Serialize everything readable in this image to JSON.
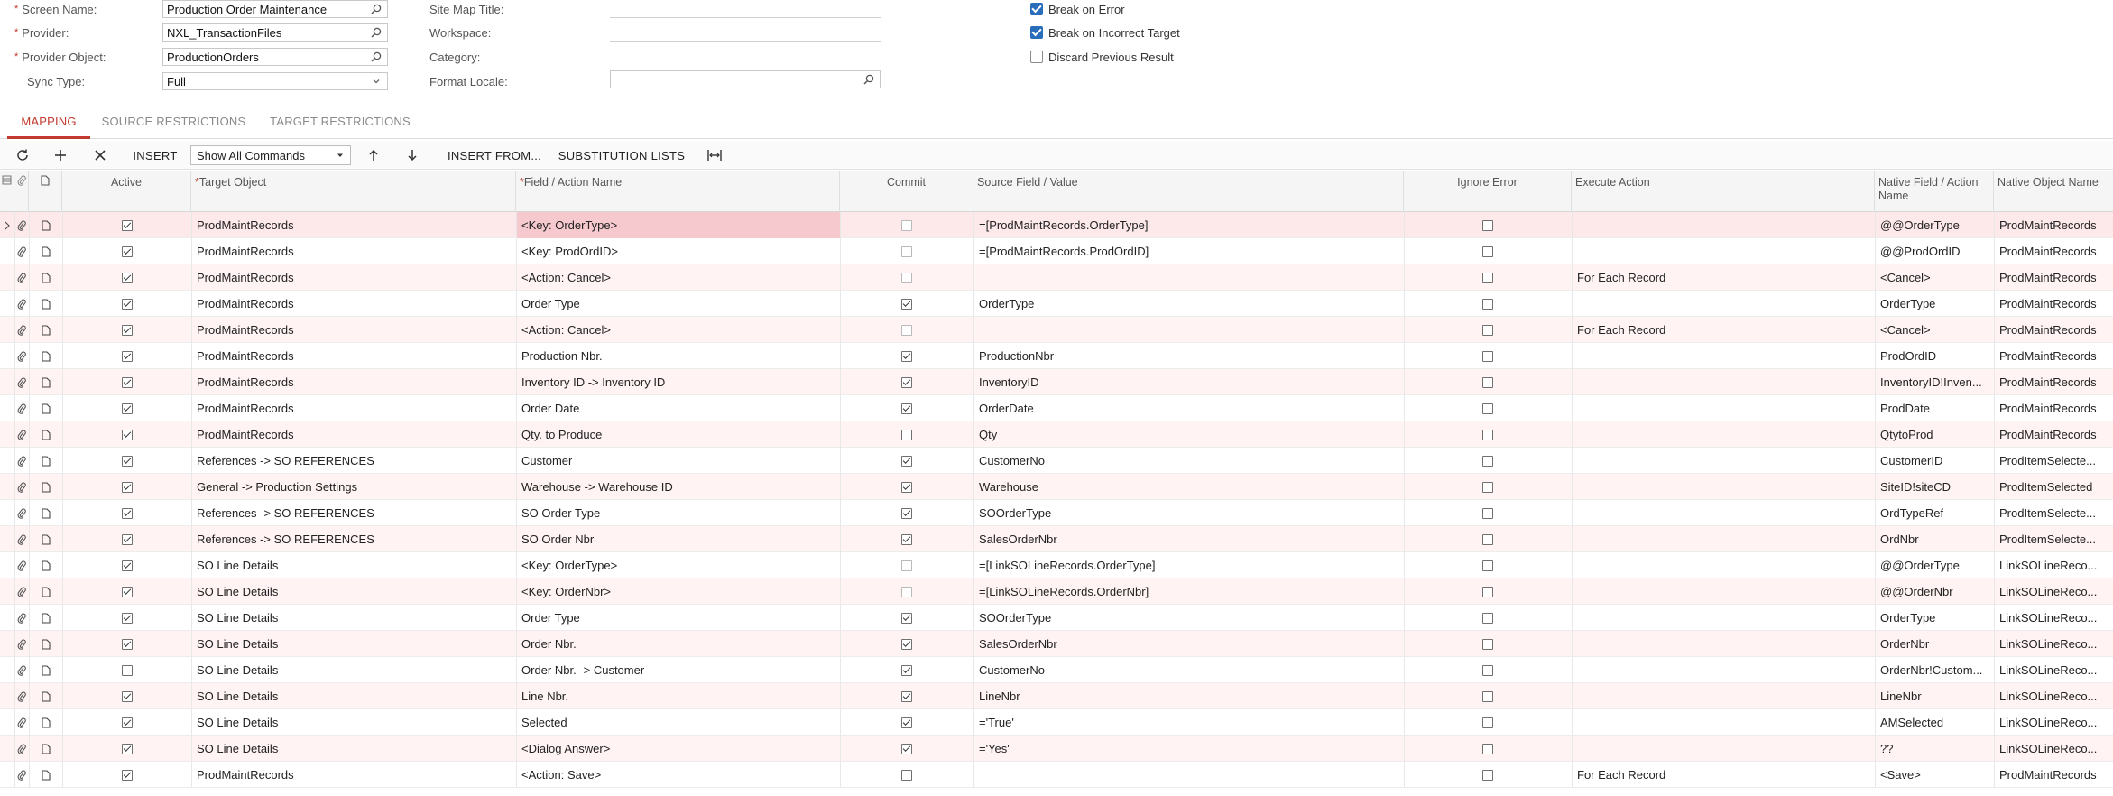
{
  "form": {
    "screen_name_label": "Screen Name:",
    "screen_name_value": "Production Order Maintenance",
    "provider_label": "Provider:",
    "provider_value": "NXL_TransactionFiles",
    "provider_object_label": "Provider Object:",
    "provider_object_value": "ProductionOrders",
    "sync_type_label": "Sync Type:",
    "sync_type_value": "Full",
    "site_map_title_label": "Site Map Title:",
    "workspace_label": "Workspace:",
    "category_label": "Category:",
    "format_locale_label": "Format Locale:",
    "format_locale_value": "",
    "required_mark": "*",
    "break_on_error_label": "Break on Error",
    "break_on_error": true,
    "break_on_incorrect_target_label": "Break on Incorrect Target",
    "break_on_incorrect_target": true,
    "discard_previous_result_label": "Discard Previous Result",
    "discard_previous_result": false
  },
  "tabs": [
    {
      "label": "MAPPING",
      "active": true
    },
    {
      "label": "SOURCE RESTRICTIONS",
      "active": false
    },
    {
      "label": "TARGET RESTRICTIONS",
      "active": false
    }
  ],
  "toolbar": {
    "refresh_icon": "refresh-icon",
    "add_icon": "plus-icon",
    "delete_icon": "close-icon",
    "insert_label": "INSERT",
    "command_filter_value": "Show All Commands",
    "move_up_icon": "arrow-up-icon",
    "move_down_icon": "arrow-down-icon",
    "insert_from_label": "INSERT FROM...",
    "substitution_lists_label": "SUBSTITUTION LISTS",
    "fit_columns_icon": "fit-columns-icon"
  },
  "grid": {
    "columns": {
      "active": "Active",
      "target_object": "Target Object",
      "field_action_name": "Field / Action Name",
      "commit": "Commit",
      "source_field_value": "Source Field / Value",
      "ignore_error": "Ignore Error",
      "execute_action": "Execute Action",
      "native_field_action_name": "Native Field / Action Name",
      "native_object_name": "Native Object Name"
    },
    "rows": [
      {
        "active": true,
        "target": "ProdMaintRecords",
        "field": "<Key: OrderType>",
        "commit": false,
        "commit_disabled": true,
        "source": "=[ProdMaintRecords.OrderType]",
        "ignore": false,
        "execute": "",
        "native_field": "@@OrderType",
        "native_object": "ProdMaintRecords"
      },
      {
        "active": true,
        "target": "ProdMaintRecords",
        "field": "<Key: ProdOrdID>",
        "commit": false,
        "commit_disabled": true,
        "source": "=[ProdMaintRecords.ProdOrdID]",
        "ignore": false,
        "execute": "",
        "native_field": "@@ProdOrdID",
        "native_object": "ProdMaintRecords"
      },
      {
        "active": true,
        "target": "ProdMaintRecords",
        "field": "<Action: Cancel>",
        "commit": false,
        "commit_disabled": true,
        "source": "",
        "ignore": false,
        "execute": "For Each Record",
        "native_field": "<Cancel>",
        "native_object": "ProdMaintRecords"
      },
      {
        "active": true,
        "target": "ProdMaintRecords",
        "field": "Order Type",
        "commit": true,
        "commit_disabled": false,
        "source": "OrderType",
        "ignore": false,
        "execute": "",
        "native_field": "OrderType",
        "native_object": "ProdMaintRecords"
      },
      {
        "active": true,
        "target": "ProdMaintRecords",
        "field": "<Action: Cancel>",
        "commit": false,
        "commit_disabled": true,
        "source": "",
        "ignore": false,
        "execute": "For Each Record",
        "native_field": "<Cancel>",
        "native_object": "ProdMaintRecords"
      },
      {
        "active": true,
        "target": "ProdMaintRecords",
        "field": "Production Nbr.",
        "commit": true,
        "commit_disabled": false,
        "source": "ProductionNbr",
        "ignore": false,
        "execute": "",
        "native_field": "ProdOrdID",
        "native_object": "ProdMaintRecords"
      },
      {
        "active": true,
        "target": "ProdMaintRecords",
        "field": "Inventory ID -> Inventory ID",
        "commit": true,
        "commit_disabled": false,
        "source": "InventoryID",
        "ignore": false,
        "execute": "",
        "native_field": "InventoryID!Inven...",
        "native_object": "ProdMaintRecords"
      },
      {
        "active": true,
        "target": "ProdMaintRecords",
        "field": "Order Date",
        "commit": true,
        "commit_disabled": false,
        "source": "OrderDate",
        "ignore": false,
        "execute": "",
        "native_field": "ProdDate",
        "native_object": "ProdMaintRecords"
      },
      {
        "active": true,
        "target": "ProdMaintRecords",
        "field": "Qty. to Produce",
        "commit": false,
        "commit_disabled": false,
        "source": "Qty",
        "ignore": false,
        "execute": "",
        "native_field": "QtytoProd",
        "native_object": "ProdMaintRecords"
      },
      {
        "active": true,
        "target": "References -> SO REFERENCES",
        "field": "Customer",
        "commit": true,
        "commit_disabled": false,
        "source": "CustomerNo",
        "ignore": false,
        "execute": "",
        "native_field": "CustomerID",
        "native_object": "ProdItemSelecte..."
      },
      {
        "active": true,
        "target": "General -> Production Settings",
        "field": "Warehouse -> Warehouse ID",
        "commit": true,
        "commit_disabled": false,
        "source": "Warehouse",
        "ignore": false,
        "execute": "",
        "native_field": "SiteID!siteCD",
        "native_object": "ProdItemSelected"
      },
      {
        "active": true,
        "target": "References -> SO REFERENCES",
        "field": "SO Order Type",
        "commit": true,
        "commit_disabled": false,
        "source": "SOOrderType",
        "ignore": false,
        "execute": "",
        "native_field": "OrdTypeRef",
        "native_object": "ProdItemSelecte..."
      },
      {
        "active": true,
        "target": "References -> SO REFERENCES",
        "field": "SO Order Nbr",
        "commit": true,
        "commit_disabled": false,
        "source": "SalesOrderNbr",
        "ignore": false,
        "execute": "",
        "native_field": "OrdNbr",
        "native_object": "ProdItemSelecte..."
      },
      {
        "active": true,
        "target": "SO Line Details",
        "field": "<Key: OrderType>",
        "commit": false,
        "commit_disabled": true,
        "source": "=[LinkSOLineRecords.OrderType]",
        "ignore": false,
        "execute": "",
        "native_field": "@@OrderType",
        "native_object": "LinkSOLineReco..."
      },
      {
        "active": true,
        "target": "SO Line Details",
        "field": "<Key: OrderNbr>",
        "commit": false,
        "commit_disabled": true,
        "source": "=[LinkSOLineRecords.OrderNbr]",
        "ignore": false,
        "execute": "",
        "native_field": "@@OrderNbr",
        "native_object": "LinkSOLineReco..."
      },
      {
        "active": true,
        "target": "SO Line Details",
        "field": "Order Type",
        "commit": true,
        "commit_disabled": false,
        "source": "SOOrderType",
        "ignore": false,
        "execute": "",
        "native_field": "OrderType",
        "native_object": "LinkSOLineReco..."
      },
      {
        "active": true,
        "target": "SO Line Details",
        "field": "Order Nbr.",
        "commit": true,
        "commit_disabled": false,
        "source": "SalesOrderNbr",
        "ignore": false,
        "execute": "",
        "native_field": "OrderNbr",
        "native_object": "LinkSOLineReco..."
      },
      {
        "active": false,
        "target": "SO Line Details",
        "field": "Order Nbr. -> Customer",
        "commit": true,
        "commit_disabled": false,
        "source": "CustomerNo",
        "ignore": false,
        "execute": "",
        "native_field": "OrderNbr!Custom...",
        "native_object": "LinkSOLineReco..."
      },
      {
        "active": true,
        "target": "SO Line Details",
        "field": "Line Nbr.",
        "commit": true,
        "commit_disabled": false,
        "source": "LineNbr",
        "ignore": false,
        "execute": "",
        "native_field": "LineNbr",
        "native_object": "LinkSOLineReco..."
      },
      {
        "active": true,
        "target": "SO Line Details",
        "field": "Selected",
        "commit": true,
        "commit_disabled": false,
        "source": "='True'",
        "ignore": false,
        "execute": "",
        "native_field": "AMSelected",
        "native_object": "LinkSOLineReco..."
      },
      {
        "active": true,
        "target": "SO Line Details",
        "field": "<Dialog Answer>",
        "commit": true,
        "commit_disabled": false,
        "source": "='Yes'",
        "ignore": false,
        "execute": "",
        "native_field": "??",
        "native_object": "LinkSOLineReco..."
      },
      {
        "active": true,
        "target": "ProdMaintRecords",
        "field": "<Action: Save>",
        "commit": false,
        "commit_disabled": false,
        "source": "",
        "ignore": false,
        "execute": "For Each Record",
        "native_field": "<Save>",
        "native_object": "ProdMaintRecords"
      }
    ]
  },
  "colors": {
    "accent": "#c23a2f",
    "selected_row": "#fde8ea",
    "selected_cell": "#f5c9cd",
    "checkbox_blue": "#2a6ebb"
  }
}
